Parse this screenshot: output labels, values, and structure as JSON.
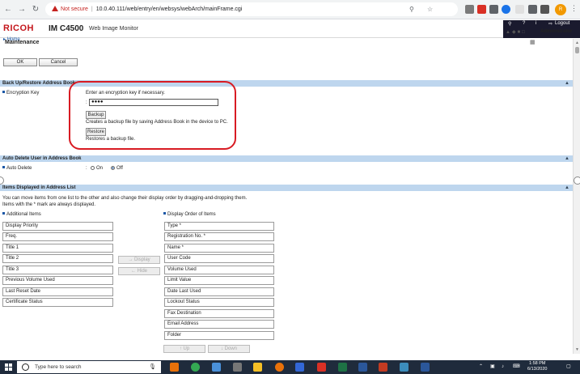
{
  "browser": {
    "security_label": "Not secure",
    "url": "10.0.40.111/web/entry/en/websys/webArch/mainFrame.cgi",
    "profile_initial": "R"
  },
  "header": {
    "brand": "RICOH",
    "model": "IM C4500",
    "product": "Web Image Monitor",
    "logout": "Logout",
    "user_role": "Administrator"
  },
  "breadcrumb": {
    "home": "Home"
  },
  "page": {
    "title": "Maintenance"
  },
  "actions": {
    "ok": "OK",
    "cancel": "Cancel"
  },
  "sections": {
    "backup": {
      "title": "Back Up/Restore Address Book",
      "encryption_label": "Encryption Key",
      "instruction": "Enter an encryption key if necessary.",
      "key_value": "●●●●",
      "backup_button": "Backup",
      "backup_desc": "Creates a backup file by saving Address Book in the device to PC.",
      "restore_button": "Restore",
      "restore_desc": "Restores a backup file."
    },
    "auto_delete": {
      "title": "Auto Delete User in Address Book",
      "label": "Auto Delete",
      "option_on": "On",
      "option_off": "Off",
      "selected": "Off"
    },
    "items_list": {
      "title": "Items Displayed in Address List",
      "help_line1": "You can move items from one list to the other and also change their display order by dragging-and-dropping them.",
      "help_line2": "Items with the * mark are always displayed.",
      "additional_heading": "Additional Items",
      "display_heading": "Display Order of Items",
      "additional_items": [
        "Display Priority",
        "Freq.",
        "Title 1",
        "Title 2",
        "Title 3",
        "Previous Volume Used",
        "Last Reset Date",
        "Certificate Status"
      ],
      "display_items": [
        "Type *",
        "Registration No. *",
        "Name *",
        "User Code",
        "Volume Used",
        "Limit Value",
        "Date Last Used",
        "Lockout Status",
        "Fax Destination",
        "Email Address",
        "Folder"
      ],
      "display_button": "Display",
      "hide_button": "Hide",
      "up_button": "Up",
      "down_button": "Down"
    }
  },
  "taskbar": {
    "search_placeholder": "Type here to search",
    "time": "1:58 PM",
    "date": "6/13/2020"
  },
  "colors": {
    "brand_red": "#c4161c",
    "section_bar": "#bed6ee",
    "annotation_red": "#d81b23",
    "taskbar": "#1f2b3c"
  }
}
